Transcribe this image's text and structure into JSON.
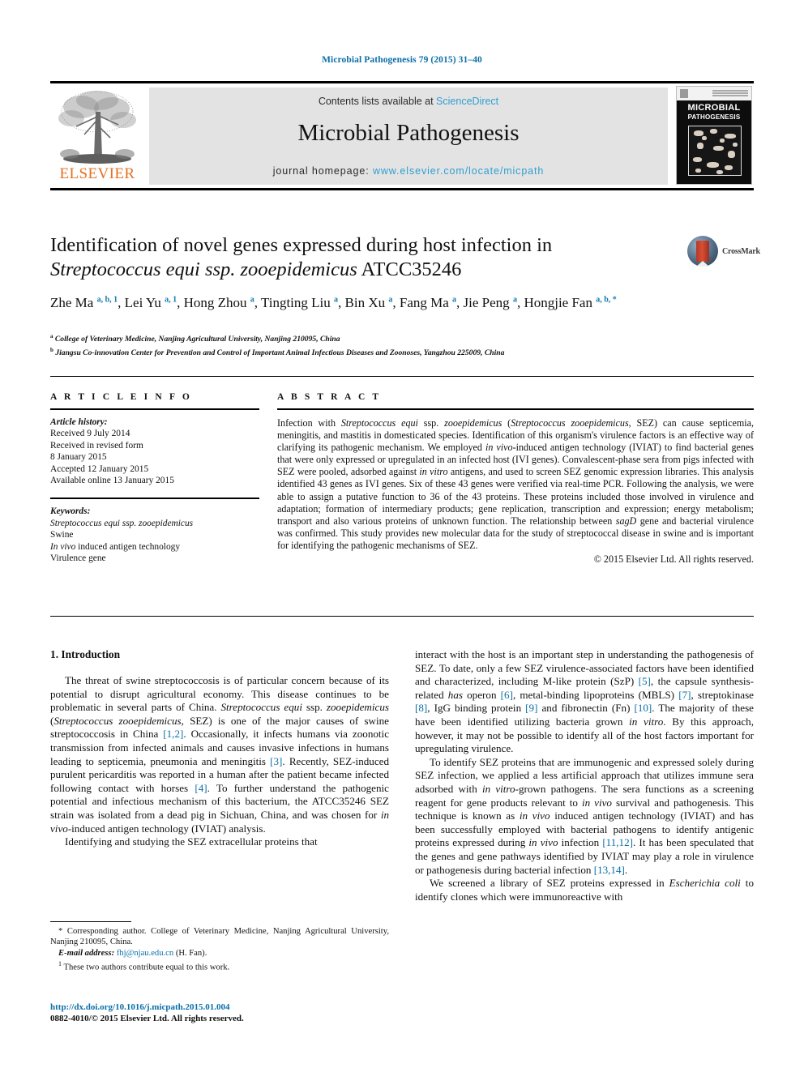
{
  "running_head": "Microbial Pathogenesis 79 (2015) 31–40",
  "masthead": {
    "contents_prefix": "Contents lists available at ",
    "sciencedirect": "ScienceDirect",
    "journal_title": "Microbial Pathogenesis",
    "homepage_prefix": "journal homepage: ",
    "homepage_url": "www.elsevier.com/locate/micpath",
    "publisher_logo_text": "ELSEVIER",
    "cover": {
      "line1": "MICROBIAL",
      "line2": "PATHOGENESIS"
    },
    "colors": {
      "link_blue": "#2f9fd0",
      "elsevier_orange": "#e37222",
      "panel_gray": "#e3e3e3"
    }
  },
  "crossmark": {
    "label": "CrossMark"
  },
  "title": {
    "line1": "Identification of novel genes expressed during host infection in",
    "line2_italic": "Streptococcus equi ssp. zooepidemicus",
    "line2_rest": " ATCC35246"
  },
  "authors": {
    "list": [
      {
        "name": "Zhe Ma",
        "marks": "a, b, 1",
        "sep": ", "
      },
      {
        "name": "Lei Yu",
        "marks": "a, 1",
        "sep": ", "
      },
      {
        "name": "Hong Zhou",
        "marks": "a",
        "sep": ", "
      },
      {
        "name": "Tingting Liu",
        "marks": "a",
        "sep": ", "
      },
      {
        "name": "Bin Xu",
        "marks": "a",
        "sep": ", "
      },
      {
        "name": "Fang Ma",
        "marks": "a",
        "sep": ", "
      },
      {
        "name": "Jie Peng",
        "marks": "a",
        "sep": ", "
      },
      {
        "name": "Hongjie Fan",
        "marks": "a, b, *",
        "sep": ""
      }
    ]
  },
  "affiliations": [
    {
      "mark": "a",
      "text": "College of Veterinary Medicine, Nanjing Agricultural University, Nanjing 210095, China"
    },
    {
      "mark": "b",
      "text": "Jiangsu Co-innovation Center for Prevention and Control of Important Animal Infectious Diseases and Zoonoses, Yangzhou 225009, China"
    }
  ],
  "article_info": {
    "heading": "A R T I C L E   I N F O",
    "history_label": "Article history:",
    "history_lines": [
      "Received 9 July 2014",
      "Received in revised form",
      "8 January 2015",
      "Accepted 12 January 2015",
      "Available online 13 January 2015"
    ],
    "keywords_label": "Keywords:",
    "keywords": [
      "Streptococcus equi ssp. zooepidemicus",
      "Swine",
      "In vivo induced antigen technology",
      "Virulence gene"
    ]
  },
  "abstract": {
    "heading": "A B S T R A C T",
    "paragraph": "Infection with Streptococcus equi ssp. zooepidemicus (Streptococcus zooepidemicus, SEZ) can cause septicemia, meningitis, and mastitis in domesticated species. Identification of this organism's virulence factors is an effective way of clarifying its pathogenic mechanism. We employed in vivo-induced antigen technology (IVIAT) to find bacterial genes that were only expressed or upregulated in an infected host (IVI genes). Convalescent-phase sera from pigs infected with SEZ were pooled, adsorbed against in vitro antigens, and used to screen SEZ genomic expression libraries. This analysis identified 43 genes as IVI genes. Six of these 43 genes were verified via real-time PCR. Following the analysis, we were able to assign a putative function to 36 of the 43 proteins. These proteins included those involved in virulence and adaptation; formation of intermediary products; gene replication, transcription and expression; energy metabolism; transport and also various proteins of unknown function. The relationship between sagD gene and bacterial virulence was confirmed. This study provides new molecular data for the study of streptococcal disease in swine and is important for identifying the pathogenic mechanisms of SEZ.",
    "copyright": "© 2015 Elsevier Ltd. All rights reserved."
  },
  "introduction": {
    "heading": "1.  Introduction",
    "left_paragraphs": [
      "The threat of swine streptococcosis is of particular concern because of its potential to disrupt agricultural economy. This disease continues to be problematic in several parts of China. Streptococcus equi ssp. zooepidemicus (Streptococcus zooepidemicus, SEZ) is one of the major causes of swine streptococcosis in China [1,2]. Occasionally, it infects humans via zoonotic transmission from infected animals and causes invasive infections in humans leading to septicemia, pneumonia and meningitis [3]. Recently, SEZ-induced purulent pericarditis was reported in a human after the patient became infected following contact with horses [4]. To further understand the pathogenic potential and infectious mechanism of this bacterium, the ATCC35246 SEZ strain was isolated from a dead pig in Sichuan, China, and was chosen for in vivo-induced antigen technology (IVIAT) analysis.",
      "Identifying and studying the SEZ extracellular proteins that"
    ],
    "right_paragraphs": [
      "interact with the host is an important step in understanding the pathogenesis of SEZ. To date, only a few SEZ virulence-associated factors have been identified and characterized, including M-like protein (SzP) [5], the capsule synthesis-related has operon [6], metal-binding lipoproteins (MBLS) [7], streptokinase [8], IgG binding protein [9] and fibronectin (Fn) [10]. The majority of these have been identified utilizing bacteria grown in vitro. By this approach, however, it may not be possible to identify all of the host factors important for upregulating virulence.",
      "To identify SEZ proteins that are immunogenic and expressed solely during SEZ infection, we applied a less artificial approach that utilizes immune sera adsorbed with in vitro-grown pathogens. The sera functions as a screening reagent for gene products relevant to in vivo survival and pathogenesis. This technique is known as in vivo induced antigen technology (IVIAT) and has been successfully employed with bacterial pathogens to identify antigenic proteins expressed during in vivo infection [11,12]. It has been speculated that the genes and gene pathways identified by IVIAT may play a role in virulence or pathogenesis during bacterial infection [13,14].",
      "We screened a library of SEZ proteins expressed in Escherichia coli to identify clones which were immunoreactive with"
    ]
  },
  "footnotes": {
    "corresponding": "* Corresponding author. College of Veterinary Medicine, Nanjing Agricultural University, Nanjing 210095, China.",
    "email_label": "E-mail address:",
    "email": "fhj@njau.edu.cn",
    "email_suffix": " (H. Fan).",
    "equal_contrib_mark": "1",
    "equal_contrib": "These two authors contribute equal to this work."
  },
  "doi": {
    "url": "http://dx.doi.org/10.1016/j.micpath.2015.01.004",
    "copyright": "0882-4010/© 2015 Elsevier Ltd. All rights reserved."
  }
}
